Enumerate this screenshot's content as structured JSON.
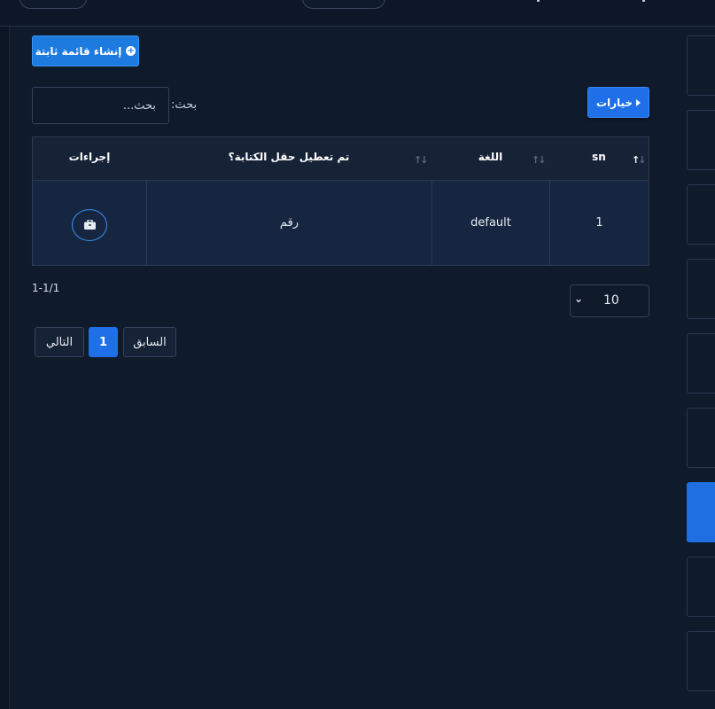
{
  "toolbar": {
    "create_label": "إنشاء قائمة ثابتة",
    "options_label": "خيارات"
  },
  "search": {
    "label": "بحث:",
    "placeholder": "بحث..."
  },
  "table": {
    "headers": {
      "sn": "sn",
      "language": "اللغة",
      "typing_disabled": "تم تعطيل حقل الكتابة؟",
      "actions": "إجراءات"
    },
    "rows": [
      {
        "sn": "1",
        "language": "default",
        "typing_disabled": "رقم"
      }
    ]
  },
  "pagination": {
    "range": "1-1/1",
    "page_size": "10",
    "next": "التالي",
    "current": "1",
    "prev": "السابق"
  },
  "icons": {
    "create": "plus-circle-icon",
    "options": "caret-left-icon",
    "sort": "sort-arrows-icon",
    "action": "briefcase-icon",
    "dropdown": "chevron-down-icon"
  },
  "colors": {
    "background": "#0f1a2b",
    "accent": "#1f70e8",
    "border": "#2c3a53"
  }
}
